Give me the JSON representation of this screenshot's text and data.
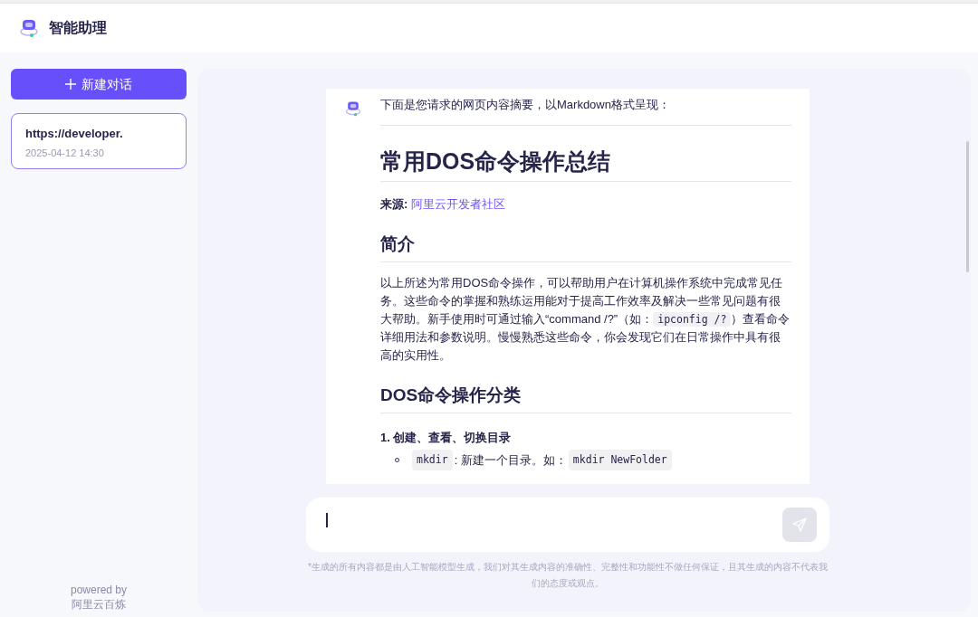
{
  "header": {
    "title": "智能助理"
  },
  "sidebar": {
    "new_chat_button": "新建对话",
    "conversations": [
      {
        "title": "https://developer.",
        "time": "2025-04-12 14:30",
        "selected": true
      }
    ],
    "footer": [
      "powered by",
      "阿里云百炼"
    ]
  },
  "message": {
    "intro": "下面是您请求的网页内容摘要，以Markdown格式呈现：",
    "blocks": [
      {
        "kind": "rule"
      },
      {
        "kind": "h1",
        "text": "常用DOS命令操作总结"
      },
      {
        "kind": "source",
        "label": "来源:",
        "link": "阿里云开发者社区"
      },
      {
        "kind": "h2",
        "text": "简介"
      },
      {
        "kind": "paragraph",
        "parts": [
          {
            "kind": "text",
            "text": "以上所述为常用DOS命令操作，可以帮助用户在计算机操作系统中完成常见任务。这些命令的掌握和熟练运用能对于提高工作效率及解决一些常见问题有很大帮助。新手使用时可通过输入“command /?”（如："
          },
          {
            "kind": "code",
            "text": "ipconfig /?"
          },
          {
            "kind": "text",
            "text": "）查看命令详细用法和参数说明。慢慢熟悉这些命令，你会发现它们在日常操作中具有很高的实用性。"
          }
        ]
      },
      {
        "kind": "h2",
        "text": "DOS命令操作分类"
      },
      {
        "kind": "ordered",
        "number": "1.",
        "title": "创建、查看、切换目录",
        "items": [
          [
            {
              "kind": "code",
              "text": "mkdir"
            },
            {
              "kind": "text",
              "text": ": 新建一个目录。如："
            },
            {
              "kind": "code",
              "text": "mkdir NewFolder"
            }
          ]
        ]
      }
    ]
  },
  "composer": {
    "send_disabled": true
  },
  "disclaimer": "*生成的所有内容都是由人工智能模型生成，我们对其生成内容的准确性、完整性和功能性不做任何保证，且其生成的内容不代表我们的态度或观点。"
}
